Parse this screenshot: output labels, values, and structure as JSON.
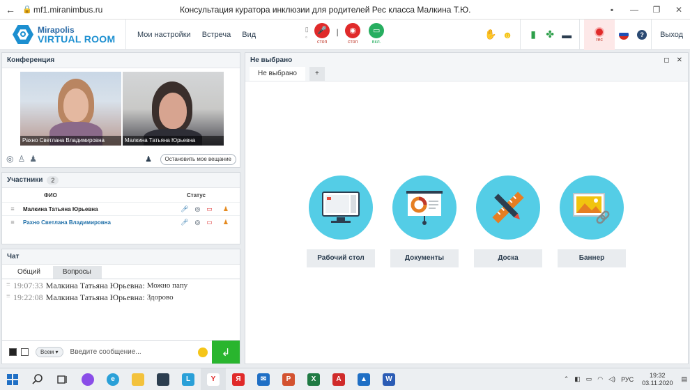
{
  "browser": {
    "url": "mf1.miranimbus.ru",
    "title": "Консультация куратора инклюзии для родителей Рес класса Малкина Т.Ю."
  },
  "app": {
    "logo_line1": "Mirapolis",
    "logo_line2": "VIRTUAL ROOM",
    "menu": [
      "Мои настройки",
      "Встреча",
      "Вид"
    ],
    "media": {
      "mic_label": "стоп",
      "cam_label": "стоп",
      "screen_label": "вкл."
    },
    "rec_label": "rec",
    "exit_label": "Выход",
    "help_label": "?"
  },
  "conference": {
    "title": "Конференция",
    "participants": [
      "Рахно Светлана  Владимировна",
      "Малкина Татьяна  Юрьевна"
    ],
    "stop_button": "Остановить мое вещание"
  },
  "participants": {
    "title": "Участники",
    "count": "2",
    "col_name": "ФИО",
    "col_status": "Статус",
    "rows": [
      {
        "name": "Малкина Татьяна  Юрьевна"
      },
      {
        "name": "Рахно Светлана  Владимировна"
      }
    ]
  },
  "chat": {
    "title": "Чат",
    "tab_general": "Общий",
    "tab_questions": "Вопросы",
    "messages": [
      {
        "time": "19:07:33",
        "author": "Малкина Татьяна  Юрьевна:",
        "text": "Можно  папу"
      },
      {
        "time": "19:22:08",
        "author": "Малкина Татьяна  Юрьевна:",
        "text": "Здорово"
      }
    ],
    "recipient": "Всем",
    "input_placeholder": "Введите сообщение..."
  },
  "main": {
    "title": "Не выбрано",
    "tab": "Не выбрано",
    "tab_add": "+",
    "tiles": [
      "Рабочий стол",
      "Документы",
      "Доска",
      "Баннер"
    ]
  },
  "taskbar": {
    "lang": "РУС",
    "time": "19:32",
    "date": "03.11.2020"
  },
  "colors": {
    "accent_blue": "#1c8fd0",
    "tile_cyan": "#54cde6",
    "send_green": "#29b52e",
    "stop_red": "#e02a2a"
  }
}
